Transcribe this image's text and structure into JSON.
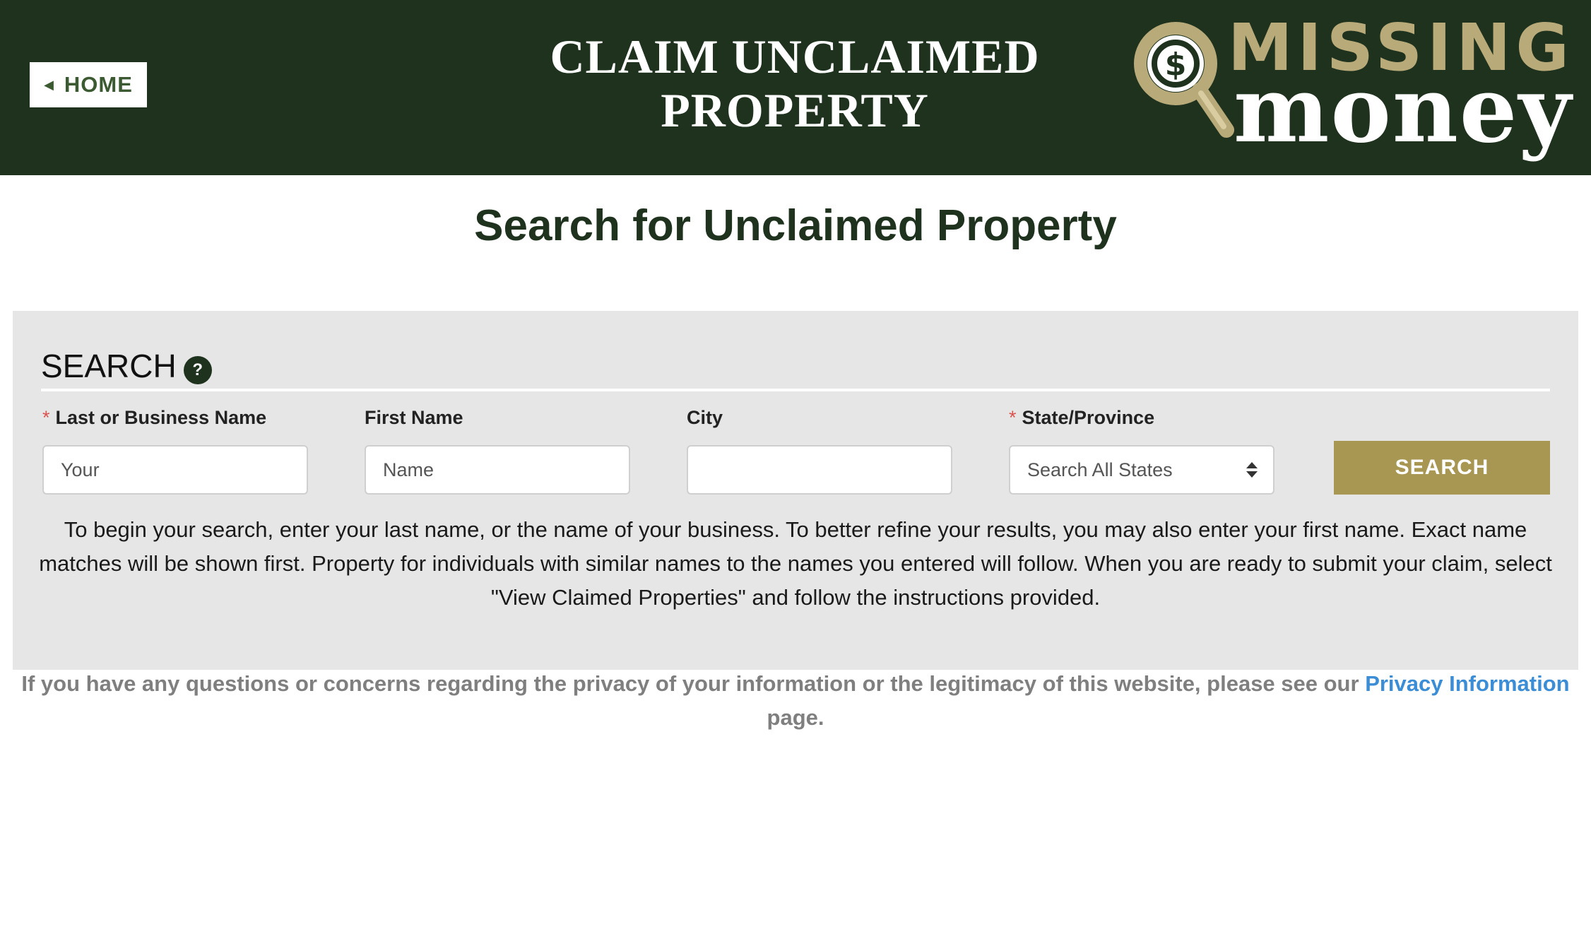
{
  "header": {
    "home_label": "HOME",
    "title_line1": "CLAIM UNCLAIMED",
    "title_line2": "PROPERTY",
    "logo_top": "MISSING",
    "logo_bottom": "money",
    "logo_symbol": "$",
    "colors": {
      "background": "#1e321e",
      "logo_gold": "#b9aa7a"
    }
  },
  "main": {
    "heading": "Search for Unclaimed Property"
  },
  "search": {
    "title": "SEARCH",
    "help_icon_glyph": "?",
    "required_marker": "*",
    "fields": {
      "last_name": {
        "label": "Last or Business Name",
        "value": "Your",
        "required": true
      },
      "first_name": {
        "label": "First Name",
        "value": "Name",
        "required": false
      },
      "city": {
        "label": "City",
        "value": "",
        "required": false
      },
      "state": {
        "label": "State/Province",
        "selected": "Search All States",
        "required": true
      }
    },
    "button_label": "SEARCH",
    "button_color": "#a89653",
    "instructions": "To begin your search, enter your last name, or the name of your business.  To better refine your results, you may also enter your first name.  Exact name matches will be shown first.  Property for individuals with similar names to the names you entered will follow.  When you are ready to submit your claim, select \"View Claimed Properties\" and follow the instructions provided."
  },
  "footer": {
    "privacy_text": "If you have any questions or concerns regarding the privacy of your information or the legitimacy of this website, please see our",
    "privacy_link": "Privacy Information",
    "privacy_suffix": "page.",
    "link_color": "#3b8dd6"
  }
}
